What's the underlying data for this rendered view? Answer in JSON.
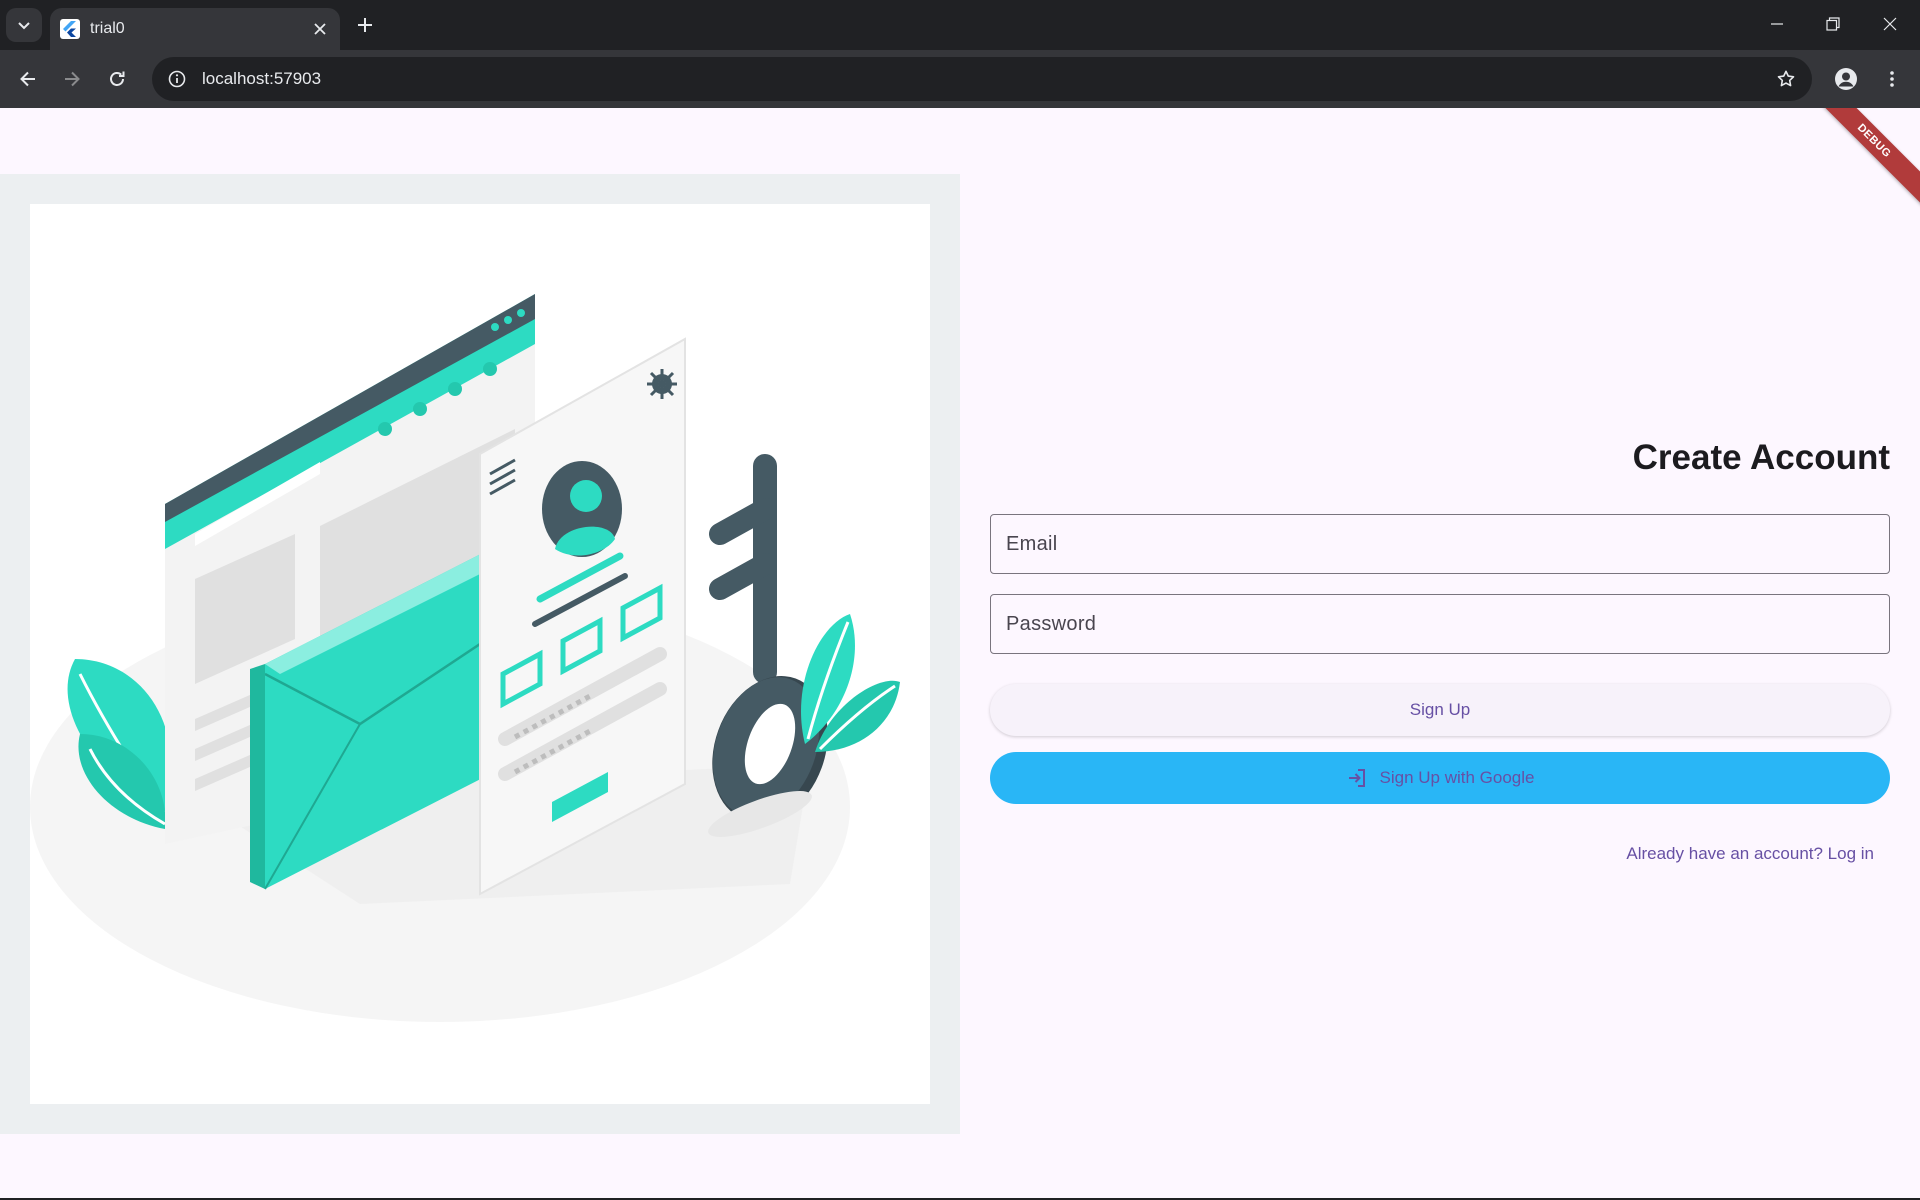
{
  "browser": {
    "tab_title": "trial0",
    "url": "localhost:57903"
  },
  "app": {
    "debug_banner": "DEBUG",
    "illustration": "login-illustration",
    "title": "Create Account",
    "email_label": "Email",
    "password_label": "Password",
    "signup_label": "Sign Up",
    "google_label": "Sign Up with Google",
    "login_link": "Already have an account? Log in"
  },
  "colors": {
    "page_bg": "#fdf7ff",
    "primary": "#6750a4",
    "google_button": "#29b6f6",
    "teal_accent": "#2ddbc2",
    "dark_slate": "#455a64"
  }
}
